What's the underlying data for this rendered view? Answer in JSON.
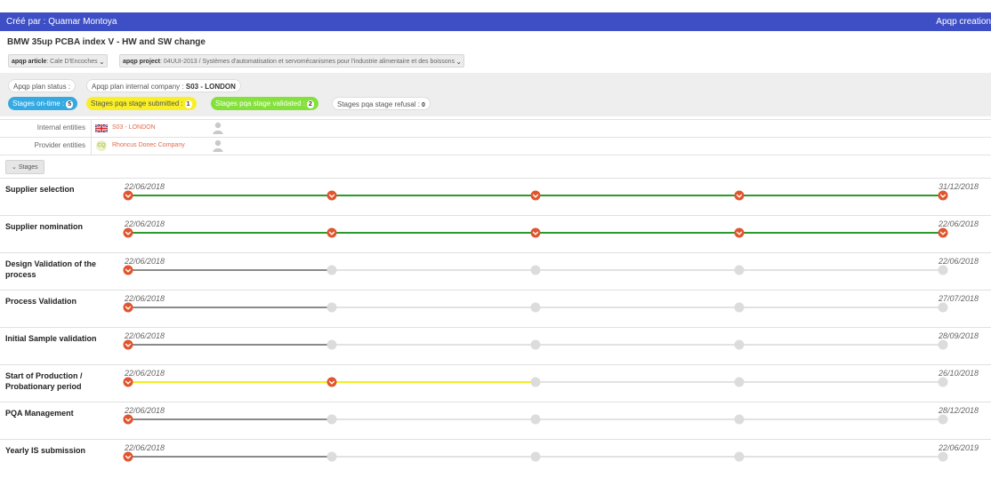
{
  "header": {
    "created_by": "Créé par : Quamar Montoya",
    "app_title": "Apqp creation"
  },
  "plan_title": "BMW 35up PCBA index V - HW and SW change",
  "filters": {
    "article_label": "apqp article",
    "article_value": ": Cale D'Encoches",
    "project_label": "apqp project",
    "project_value": ": 04UUI-2013 / Systèmes d'automatisation et servomécanismes pour l'industrie alimentaire et des boissons"
  },
  "status": {
    "plan_status_label": "Apqp plan status :",
    "internal_company_label": "Apqp plan internal company :",
    "internal_company_value": "S03 - LONDON",
    "on_time_label": "Stages on-time :",
    "on_time_count": "5",
    "submitted_label": "Stages pqa stage submitted :",
    "submitted_count": "1",
    "validated_label": "Stages pqa stage validated :",
    "validated_count": "2",
    "refusal_label": "Stages pqa stage refusal :",
    "refusal_count": "0"
  },
  "entities": {
    "internal_label": "Internal entities",
    "internal_value": "S03 - LONDON",
    "provider_label": "Provider entities",
    "provider_value": "Rhoncus Donec Company",
    "provider_logo_text": "CQ"
  },
  "stages_toggle_label": "Stages",
  "colors": {
    "header": "#3e4fc5",
    "milestone_done": "#e0552e",
    "milestone_pending": "#dcdcdc",
    "line_green": "#2a9a2a",
    "line_yellow": "#f4ee1c",
    "line_gray": "#8a8a8a",
    "line_light": "#e2e2e2"
  },
  "stages": [
    {
      "name": "Supplier selection",
      "start": "22/06/2018",
      "end": "31/12/2018",
      "done": 5,
      "line": "green"
    },
    {
      "name": "Supplier nomination",
      "start": "22/06/2018",
      "end": "22/06/2018",
      "done": 5,
      "line": "green"
    },
    {
      "name": "Design Validation of the process",
      "start": "22/06/2018",
      "end": "22/06/2018",
      "done": 1,
      "line": "gray"
    },
    {
      "name": "Process Validation",
      "start": "22/06/2018",
      "end": "27/07/2018",
      "done": 1,
      "line": "gray"
    },
    {
      "name": "Initial Sample validation",
      "start": "22/06/2018",
      "end": "28/09/2018",
      "done": 1,
      "line": "gray"
    },
    {
      "name": "Start of Production / Probationary period",
      "start": "22/06/2018",
      "end": "26/10/2018",
      "done": 2,
      "line": "yellow"
    },
    {
      "name": "PQA Management",
      "start": "22/06/2018",
      "end": "28/12/2018",
      "done": 1,
      "line": "gray"
    },
    {
      "name": "Yearly IS submission",
      "start": "22/06/2018",
      "end": "22/06/2019",
      "done": 1,
      "line": "gray"
    }
  ]
}
